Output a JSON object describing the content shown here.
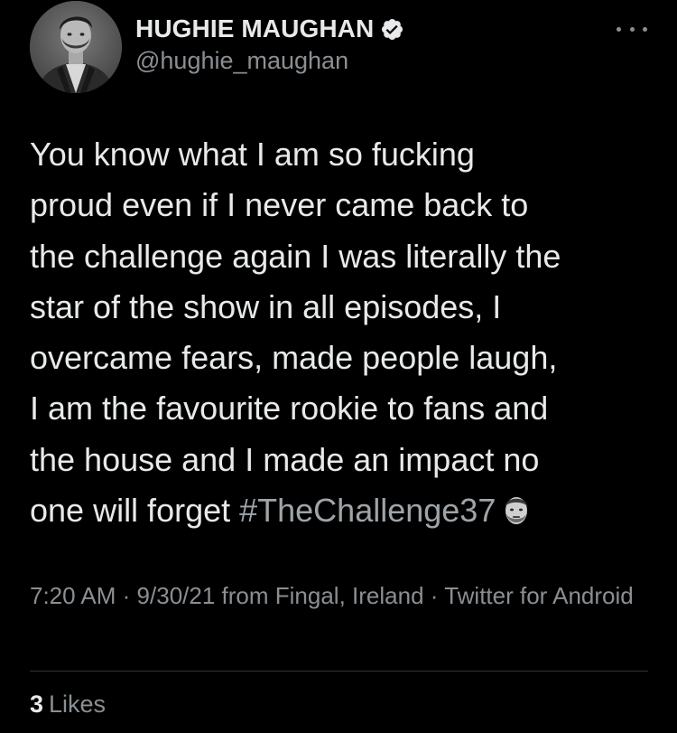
{
  "author": {
    "display_name": "HUGHIE MAUGHAN",
    "handle": "@hughie_maughan",
    "verified_icon": "verified-badge-icon",
    "avatar_icon": "profile-photo"
  },
  "tweet": {
    "text_before_hashtag": "You know what I am so fucking\nproud even if I never came back to\nthe challenge again I was literally the\nstar of the show in all episodes, I\novercame fears, made people laugh,\nI am the favourite rookie to fans and\nthe house and I made an impact no\none will forget ",
    "hashtag": "#TheChallenge37",
    "emoji": "face-emoji"
  },
  "meta": {
    "time": "7:20 AM",
    "date": "9/30/21",
    "from_prefix": "from",
    "location": "Fingal, Ireland",
    "source": "Twitter for Android",
    "separator": "·"
  },
  "stats": {
    "likes_count": "3",
    "likes_label": "Likes"
  },
  "colors": {
    "background": "#000000",
    "primary_text": "#e7e9ea",
    "secondary_text": "#8b8f93",
    "divider": "#2f3336"
  }
}
